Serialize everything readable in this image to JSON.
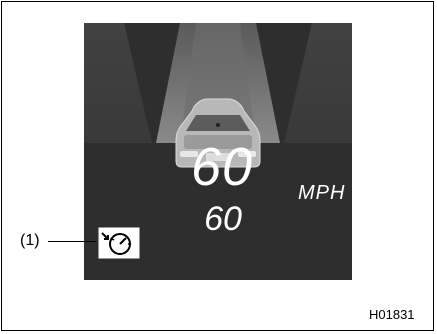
{
  "display": {
    "speed_current": "60",
    "speed_set": "60",
    "unit": "MPH"
  },
  "callout": {
    "label": "(1)"
  },
  "icons": {
    "cruise": "speedometer-with-arrow-icon"
  },
  "figure": {
    "code": "H01831"
  },
  "colors": {
    "screen_bg": "#2e2e2e",
    "text": "#ffffff"
  }
}
